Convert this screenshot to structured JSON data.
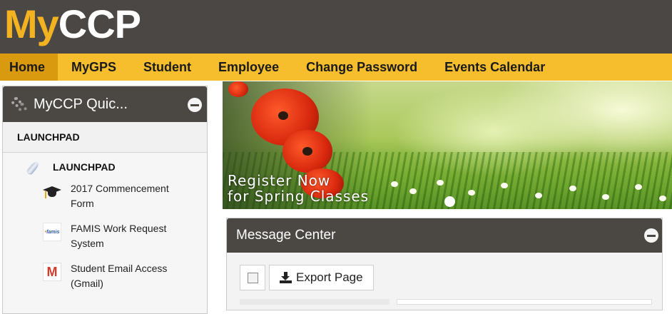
{
  "logo": {
    "part1": "My",
    "part2": "CCP"
  },
  "nav": {
    "items": [
      {
        "label": "Home",
        "active": true
      },
      {
        "label": "MyGPS"
      },
      {
        "label": "Student"
      },
      {
        "label": "Employee"
      },
      {
        "label": "Change Password"
      },
      {
        "label": "Events Calendar"
      }
    ]
  },
  "quick_panel": {
    "title": "MyCCP Quic...",
    "section": "LAUNCHPAD",
    "subsection": "LAUNCHPAD",
    "links": [
      {
        "label": "2017 Commencement Form",
        "icon": "graduation-cap-icon"
      },
      {
        "label": "FAMIS Work Request System",
        "icon": "famis-logo-icon",
        "icon_text": "famis"
      },
      {
        "label": "Student Email Access (Gmail)",
        "icon": "gmail-icon",
        "icon_text": "M"
      }
    ]
  },
  "banner": {
    "line1": "Register Now",
    "line2": "for Spring Classes"
  },
  "message_center": {
    "title": "Message Center",
    "export_label": "Export Page"
  },
  "colors": {
    "header_bg": "#4a4744",
    "nav_bg": "#f6be2c",
    "nav_active": "#d99a10",
    "logo_accent": "#f3b321",
    "panel_header": "#4b4844"
  }
}
